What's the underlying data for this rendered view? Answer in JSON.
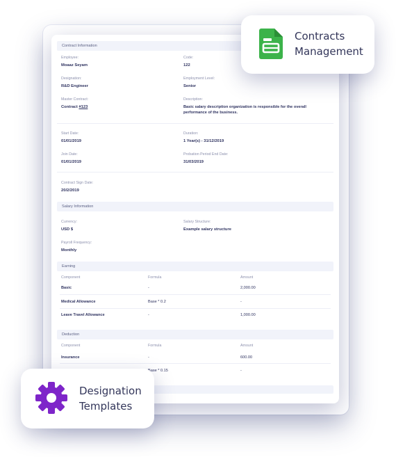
{
  "contract": {
    "section_title": "Contract Information",
    "employee_label": "Employee:",
    "employee_value": "Moaaz Seyam",
    "code_label": "Code:",
    "code_value": "122",
    "designation_label": "Designation:",
    "designation_value": "R&D Engineer",
    "employment_level_label": "Employment Level:",
    "employment_level_value": "Senior",
    "master_contract_label": "Master Contract:",
    "master_contract_prefix": "Contract ",
    "master_contract_link": "#123",
    "description_label": "Description:",
    "description_value": "Basic salary description organization is responsible for the overall performance of the business.",
    "start_date_label": "Start Date:",
    "start_date_value": "01/01/2019",
    "duration_label": "Duration:",
    "duration_value": "1 Year(s) - 31/12/2019",
    "join_date_label": "Join Date:",
    "join_date_value": "01/01/2019",
    "probation_label": "Probation Period End Date:",
    "probation_value": "31/03/2019",
    "sign_date_label": "Contract Sign Date:",
    "sign_date_value": "20/2/2019"
  },
  "salary": {
    "section_title": "Salary Information",
    "currency_label": "Currency:",
    "currency_value": "USD $",
    "structure_label": "Salary Structure:",
    "structure_value": "Example salary structure",
    "frequency_label": "Payroll Frequency:",
    "frequency_value": "Monthly"
  },
  "earning": {
    "section_title": "Earning",
    "col_component": "Component",
    "col_formula": "Formula",
    "col_amount": "Amount",
    "rows": [
      {
        "component": "Basic",
        "formula": "-",
        "amount": "2,000.00"
      },
      {
        "component": "Medical Allowance",
        "formula": "Base * 0.2",
        "amount": "-"
      },
      {
        "component": "Leave Travel Allowance",
        "formula": "-",
        "amount": "1,000.00"
      }
    ]
  },
  "deduction": {
    "section_title": "Deduction",
    "col_component": "Component",
    "col_formula": "Formula",
    "col_amount": "Amount",
    "rows": [
      {
        "component": "Insurance",
        "formula": "-",
        "amount": "600.00"
      },
      {
        "component": "",
        "formula": "Base * 0.15",
        "amount": "-"
      }
    ]
  },
  "badges": {
    "contracts_title_line1": "Contracts",
    "contracts_title_line2": "Management",
    "contracts_icon": "document-icon",
    "contracts_color": "#3cb34a",
    "designation_title_line1": "Designation",
    "designation_title_line2": "Templates",
    "designation_icon": "gear-icon",
    "designation_color": "#7e25c9"
  }
}
